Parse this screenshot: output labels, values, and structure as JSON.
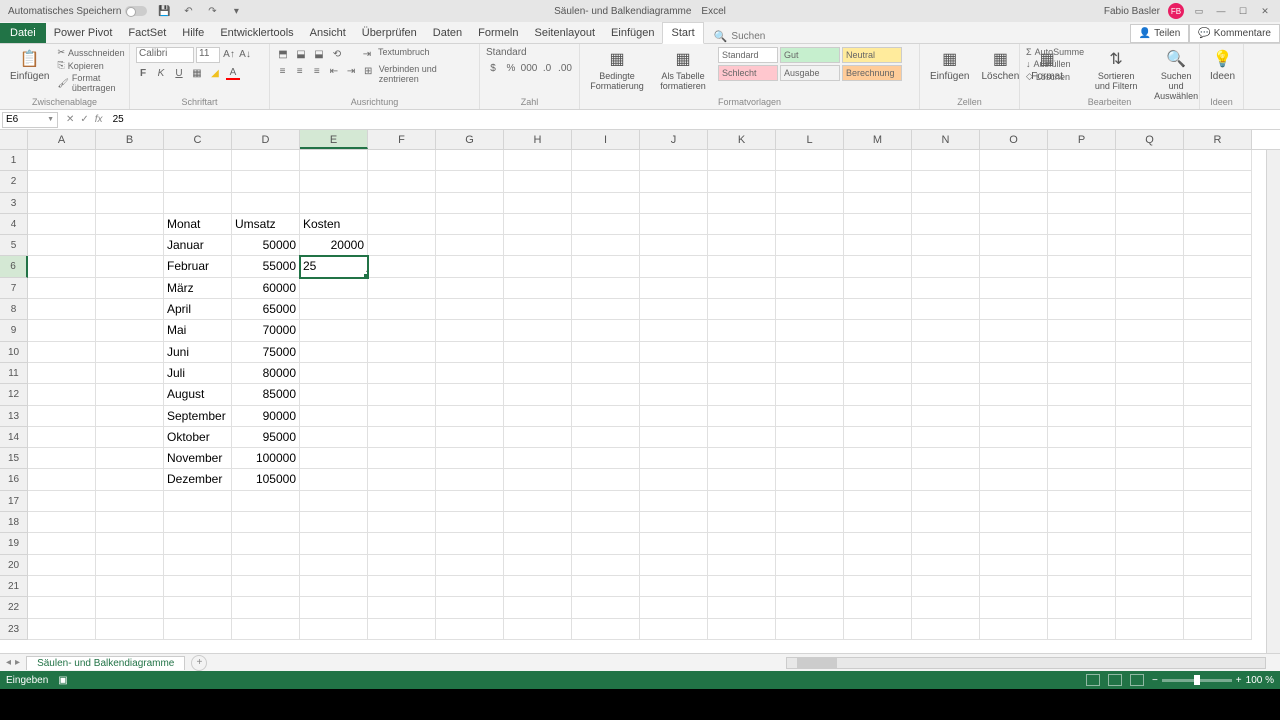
{
  "titlebar": {
    "autosave": "Automatisches Speichern",
    "docname": "Säulen- und Balkendiagramme",
    "appname": "Excel",
    "username": "Fabio Basler",
    "avatar_initials": "FB"
  },
  "tabs": {
    "file": "Datei",
    "items": [
      "Start",
      "Einfügen",
      "Seitenlayout",
      "Formeln",
      "Daten",
      "Überprüfen",
      "Ansicht",
      "Entwicklertools",
      "Hilfe",
      "FactSet",
      "Power Pivot"
    ],
    "active": "Start",
    "search_placeholder": "Suchen",
    "share": "Teilen",
    "comments": "Kommentare"
  },
  "ribbon": {
    "clipboard": {
      "paste": "Einfügen",
      "cut": "Ausschneiden",
      "copy": "Kopieren",
      "format": "Format übertragen",
      "label": "Zwischenablage"
    },
    "font": {
      "name": "Calibri",
      "size": "11",
      "label": "Schriftart"
    },
    "alignment": {
      "wrap": "Textumbruch",
      "merge": "Verbinden und zentrieren",
      "label": "Ausrichtung"
    },
    "number": {
      "format": "Standard",
      "label": "Zahl"
    },
    "styles": {
      "cond": "Bedingte Formatierung",
      "table": "Als Tabelle formatieren",
      "cells": [
        "Standard",
        "Gut",
        "Neutral",
        "Schlecht",
        "Ausgabe",
        "Berechnung"
      ],
      "label": "Formatvorlagen"
    },
    "cells_group": {
      "insert": "Einfügen",
      "delete": "Löschen",
      "format": "Format",
      "label": "Zellen"
    },
    "editing": {
      "sum": "AutoSumme",
      "fill": "Ausfüllen",
      "clear": "Löschen",
      "sort": "Sortieren und Filtern",
      "find": "Suchen und Auswählen",
      "label": "Bearbeiten"
    },
    "ideas": {
      "btn": "Ideen",
      "label": "Ideen"
    }
  },
  "namebox": "E6",
  "formula": "25",
  "columns": [
    "A",
    "B",
    "C",
    "D",
    "E",
    "F",
    "G",
    "H",
    "I",
    "J",
    "K",
    "L",
    "M",
    "N",
    "O",
    "P",
    "Q",
    "R"
  ],
  "active_col": "E",
  "active_row": 6,
  "rows_count": 23,
  "cells": {
    "C4": "Monat",
    "D4": "Umsatz",
    "E4": "Kosten",
    "C5": "Januar",
    "D5": "50000",
    "E5": "20000",
    "C6": "Februar",
    "D6": "55000",
    "E6": "25",
    "C7": "März",
    "D7": "60000",
    "C8": "April",
    "D8": "65000",
    "C9": "Mai",
    "D9": "70000",
    "C10": "Juni",
    "D10": "75000",
    "C11": "Juli",
    "D11": "80000",
    "C12": "August",
    "D12": "85000",
    "C13": "September",
    "D13": "90000",
    "C14": "Oktober",
    "D14": "95000",
    "C15": "November",
    "D15": "100000",
    "C16": "Dezember",
    "D16": "105000"
  },
  "right_align_cols": [
    "D",
    "E"
  ],
  "editing_cell": "E6",
  "chart_data": {
    "type": "table",
    "title": "Monat / Umsatz / Kosten",
    "categories": [
      "Januar",
      "Februar",
      "März",
      "April",
      "Mai",
      "Juni",
      "Juli",
      "August",
      "September",
      "Oktober",
      "November",
      "Dezember"
    ],
    "series": [
      {
        "name": "Umsatz",
        "values": [
          50000,
          55000,
          60000,
          65000,
          70000,
          75000,
          80000,
          85000,
          90000,
          95000,
          100000,
          105000
        ]
      },
      {
        "name": "Kosten",
        "values": [
          20000,
          null,
          null,
          null,
          null,
          null,
          null,
          null,
          null,
          null,
          null,
          null
        ]
      }
    ]
  },
  "sheet": {
    "name": "Säulen- und Balkendiagramme"
  },
  "status": {
    "mode": "Eingeben",
    "zoom": "100 %"
  }
}
